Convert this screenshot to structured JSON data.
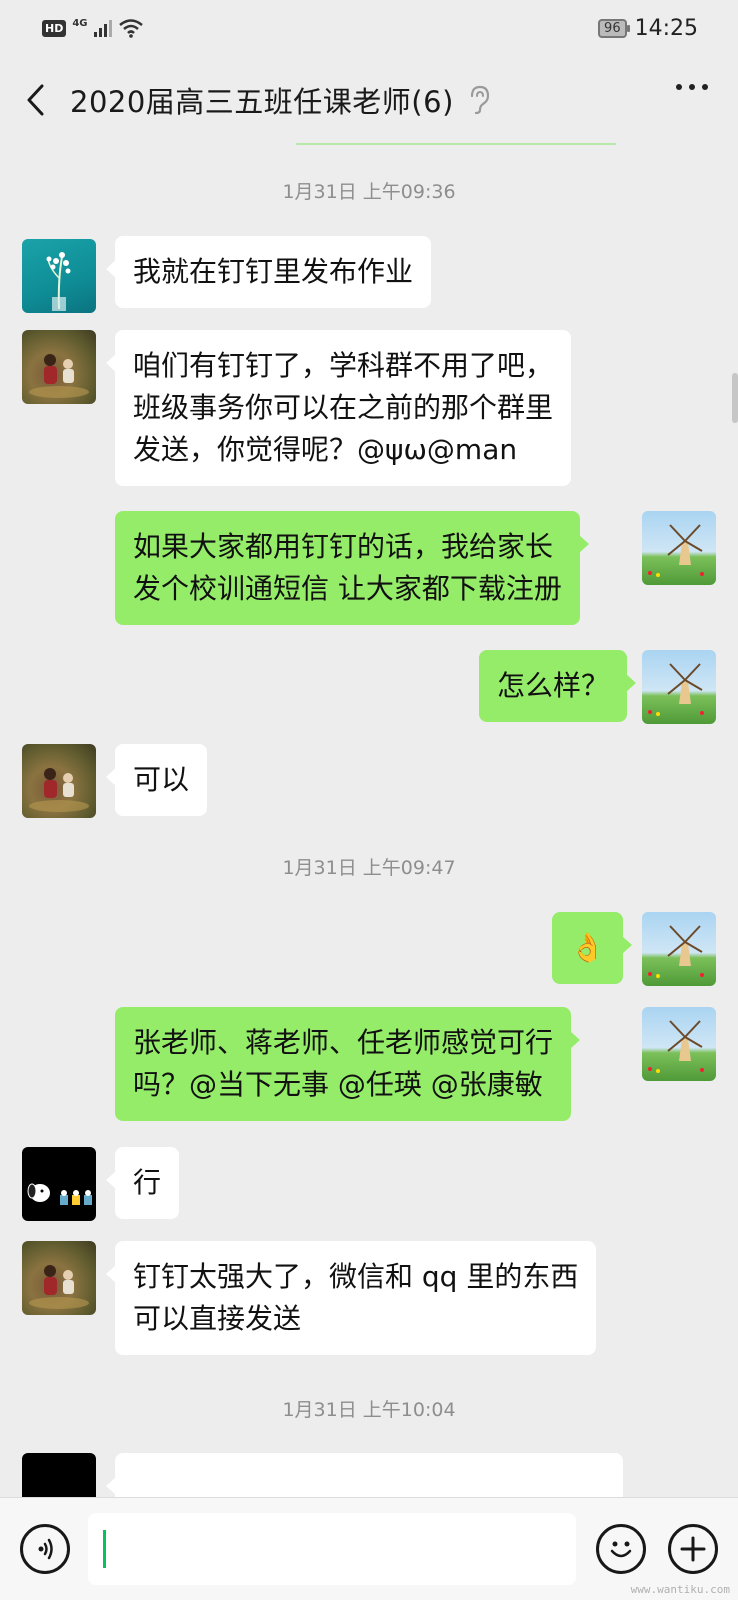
{
  "status_bar": {
    "hd": "HD",
    "network": "4G",
    "battery": "96",
    "time": "14:25"
  },
  "header": {
    "title": "2020届高三五班任课老师(6)"
  },
  "messages": [
    {
      "type": "time",
      "text": "1月31日 上午09:36"
    },
    {
      "type": "in",
      "avatar": "flower-avatar",
      "text": "我就在钉钉里发布作业"
    },
    {
      "type": "in",
      "avatar": "photo-avatar",
      "text": "咱们有钉钉了，学科群不用了吧，\n班级事务你可以在之前的那个群里\n发送，你觉得呢？@ψω@man"
    },
    {
      "type": "out",
      "avatar": "windmill-avatar",
      "text": "如果大家都用钉钉的话，我给家长\n发个校训通短信 让大家都下载注册"
    },
    {
      "type": "out",
      "avatar": "windmill-avatar",
      "text": "怎么样？"
    },
    {
      "type": "in",
      "avatar": "photo-avatar",
      "text": "可以"
    },
    {
      "type": "time",
      "text": "1月31日 上午09:47"
    },
    {
      "type": "out",
      "avatar": "windmill-avatar",
      "text": "👌"
    },
    {
      "type": "out",
      "avatar": "windmill-avatar",
      "text": "张老师、蒋老师、任老师感觉可行\n吗？@当下无事 @任瑛 @张康敏"
    },
    {
      "type": "in",
      "avatar": "snoopy-avatar",
      "text": "行"
    },
    {
      "type": "in",
      "avatar": "photo-avatar",
      "text": "钉钉太强大了，微信和 qq 里的东西\n可以直接发送"
    },
    {
      "type": "time",
      "text": "1月31日 上午10:04"
    }
  ],
  "input": {
    "value": "",
    "placeholder": ""
  },
  "watermark": "www.wantiku.com",
  "colors": {
    "background": "#ededed",
    "outgoing_bubble": "#95ec69",
    "incoming_bubble": "#ffffff",
    "cursor": "#07c160"
  }
}
